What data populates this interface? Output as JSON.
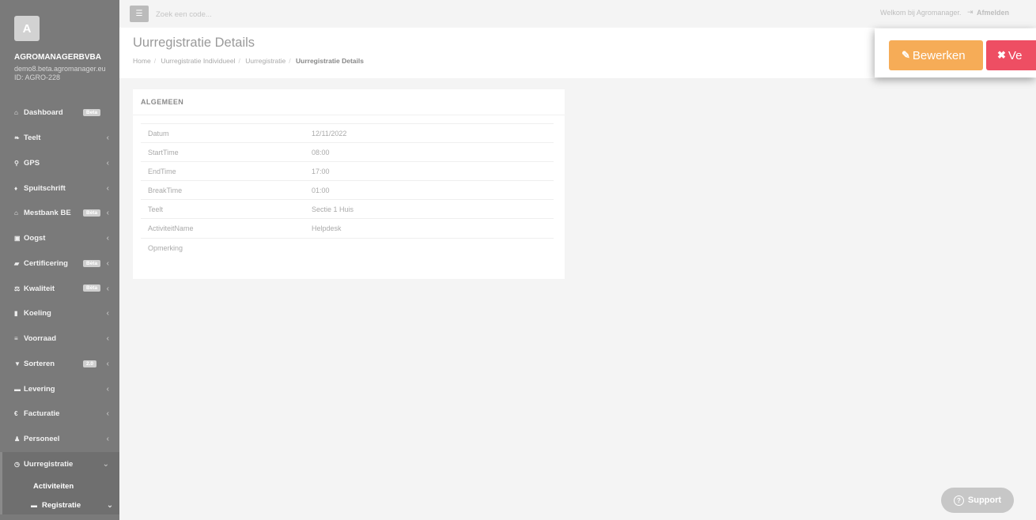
{
  "sidebar": {
    "avatar_letter": "A",
    "company": "AGROMANAGERBVBA",
    "domain": "demo8.beta.agromanager.eu",
    "org_id": "ID: AGRO-228",
    "items": [
      {
        "label": "Dashboard",
        "icon": "home-icon",
        "glyph": "⌂",
        "badge": "Beta",
        "chevron": ""
      },
      {
        "label": "Teelt",
        "icon": "leaf-icon",
        "glyph": "❧",
        "badge": "",
        "chevron": "‹"
      },
      {
        "label": "GPS",
        "icon": "map-marker-icon",
        "glyph": "⚲",
        "badge": "",
        "chevron": "‹"
      },
      {
        "label": "Spuitschrift",
        "icon": "tint-icon",
        "glyph": "♦",
        "badge": "",
        "chevron": "‹"
      },
      {
        "label": "Mestbank BE",
        "icon": "bank-icon",
        "glyph": "⌂",
        "badge": "Bèta",
        "chevron": "‹"
      },
      {
        "label": "Oogst",
        "icon": "basket-icon",
        "glyph": "▣",
        "badge": "",
        "chevron": "‹"
      },
      {
        "label": "Certificering",
        "icon": "book-icon",
        "glyph": "▰",
        "badge": "Bèta",
        "chevron": "‹"
      },
      {
        "label": "Kwaliteit",
        "icon": "balance-scale-icon",
        "glyph": "⚖",
        "badge": "Bèta",
        "chevron": "‹"
      },
      {
        "label": "Koeling",
        "icon": "thermometer-icon",
        "glyph": "▮",
        "badge": "",
        "chevron": "‹"
      },
      {
        "label": "Voorraad",
        "icon": "list-icon",
        "glyph": "≡",
        "badge": "",
        "chevron": "‹"
      },
      {
        "label": "Sorteren",
        "icon": "filter-icon",
        "glyph": "▼",
        "badge": "2.0",
        "chevron": "‹"
      },
      {
        "label": "Levering",
        "icon": "truck-icon",
        "glyph": "▬",
        "badge": "",
        "chevron": "‹"
      },
      {
        "label": "Facturatie",
        "icon": "euro-icon",
        "glyph": "€",
        "badge": "",
        "chevron": "‹"
      },
      {
        "label": "Personeel",
        "icon": "user-icon",
        "glyph": "♟",
        "badge": "",
        "chevron": "‹"
      },
      {
        "label": "Uurregistratie",
        "icon": "clock-icon",
        "glyph": "◷",
        "badge": "",
        "chevron": "⌄"
      }
    ],
    "sub_items": [
      {
        "label": "Activiteiten",
        "icon": "",
        "chevron": ""
      },
      {
        "label": "Registratie",
        "icon": "folder-open-icon",
        "glyph": "▬",
        "chevron": "⌄"
      }
    ]
  },
  "topbar": {
    "menu_toggle_icon": "hamburger-icon",
    "search_placeholder": "Zoek een code...",
    "welcome": "Welkom bij Agromanager.",
    "logout_icon": "sign-out-icon",
    "logout": "Afmelden"
  },
  "header": {
    "title": "Uurregistratie Details",
    "breadcrumb": [
      "Home",
      "Uurregistratie Individueel",
      "Uurregistratie",
      "Uurregistratie Details"
    ]
  },
  "actions": {
    "edit_label": "Bewerken",
    "edit_icon": "pencil-icon",
    "delete_label": "Ve",
    "delete_icon": "times-icon",
    "edit_color": "#f6ac57",
    "delete_color": "#ee4e63"
  },
  "card": {
    "title": "ALGEMEEN",
    "rows": [
      {
        "key": "Datum",
        "value": "12/11/2022"
      },
      {
        "key": "StartTime",
        "value": "08:00"
      },
      {
        "key": "EndTime",
        "value": "17:00"
      },
      {
        "key": "BreakTime",
        "value": "01:00"
      },
      {
        "key": "Teelt",
        "value": "Sectie 1 Huis"
      },
      {
        "key": "ActiviteitName",
        "value": "Helpdesk"
      },
      {
        "key": "Opmerking",
        "value": ""
      }
    ]
  },
  "support": {
    "label": "Support",
    "icon": "question-circle-icon"
  }
}
